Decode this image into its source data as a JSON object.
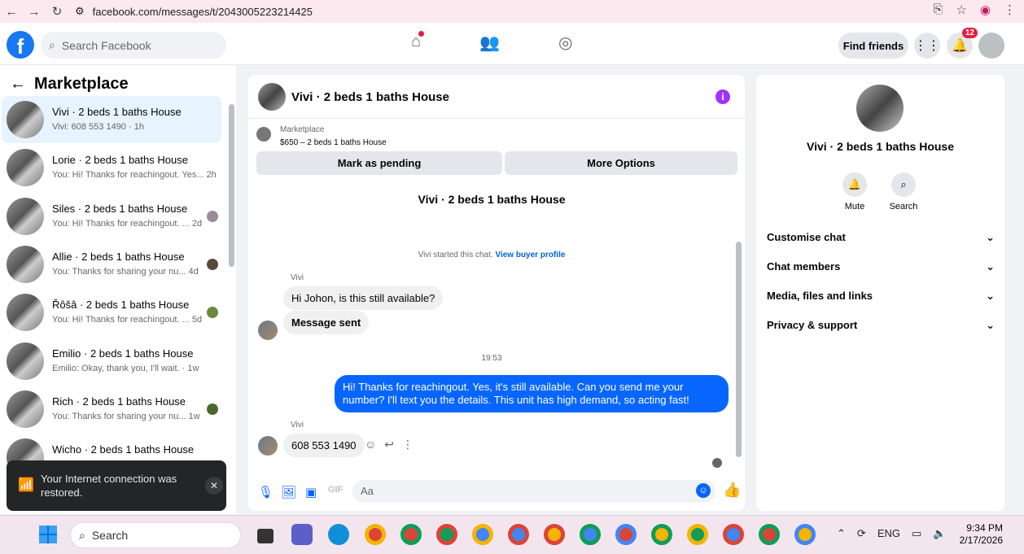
{
  "browser": {
    "url": "facebook.com/messages/t/2043005223214425"
  },
  "topbar": {
    "search_placeholder": "Search Facebook",
    "find_friends": "Find friends",
    "notifications_count": "12"
  },
  "left": {
    "title": "Marketplace",
    "conversations": [
      {
        "name": "Vivi · 2 beds 1 baths House",
        "snippet": "Vivi: 608 553 1490 · 1h"
      },
      {
        "name": "Lorie · 2 beds 1 baths House",
        "snippet": "You: Hi! Thanks for reachingout. Yes... 2h"
      },
      {
        "name": "Siles · 2 beds 1 baths House",
        "snippet": "You: Hi! Thanks for reachingout. ... 2d"
      },
      {
        "name": "Allie · 2 beds 1 baths House",
        "snippet": "You: Thanks for sharing your nu... 4d"
      },
      {
        "name": "Řôšâ · 2 beds 1 baths House",
        "snippet": "You: Hi! Thanks for reachingout. ... 5d"
      },
      {
        "name": "Emilio · 2 beds 1 baths House",
        "snippet": "Emilio: Okay, thank you, I'll wait. · 1w"
      },
      {
        "name": "Rich · 2 beds 1 baths House",
        "snippet": "You: Thanks for sharing your nu... 1w"
      },
      {
        "name": "Wicho · 2 beds 1 baths House",
        "snippet": ""
      }
    ],
    "toast": "Your Internet connection was restored."
  },
  "chat": {
    "title": "Vivi · 2 beds 1 baths House",
    "marketplace_label": "Marketplace",
    "listing": "$650 – 2 beds 1 baths House",
    "mark_pending": "Mark as pending",
    "more_options": "More Options",
    "started_text": "Vivi started this chat.",
    "buyer_profile": "View buyer profile",
    "sender": "Vivi",
    "msg1": "Hi Johon, is this still available?",
    "msg2": "Message sent",
    "time": "19:53",
    "msg_out": "Hi! Thanks for reachingout. Yes, it's still available. Can you send me your number? I'll text you the details. This unit has high demand, so acting fast!",
    "msg3": "608 553 1490",
    "composer_placeholder": "Aa"
  },
  "right": {
    "name": "Vivi · 2 beds 1 baths House",
    "mute": "Mute",
    "search": "Search",
    "sections": [
      "Customise chat",
      "Chat members",
      "Media, files and links",
      "Privacy & support"
    ]
  },
  "taskbar": {
    "search": "Search",
    "lang": "ENG",
    "time": "9:34 PM",
    "date": "2/17/2026"
  }
}
